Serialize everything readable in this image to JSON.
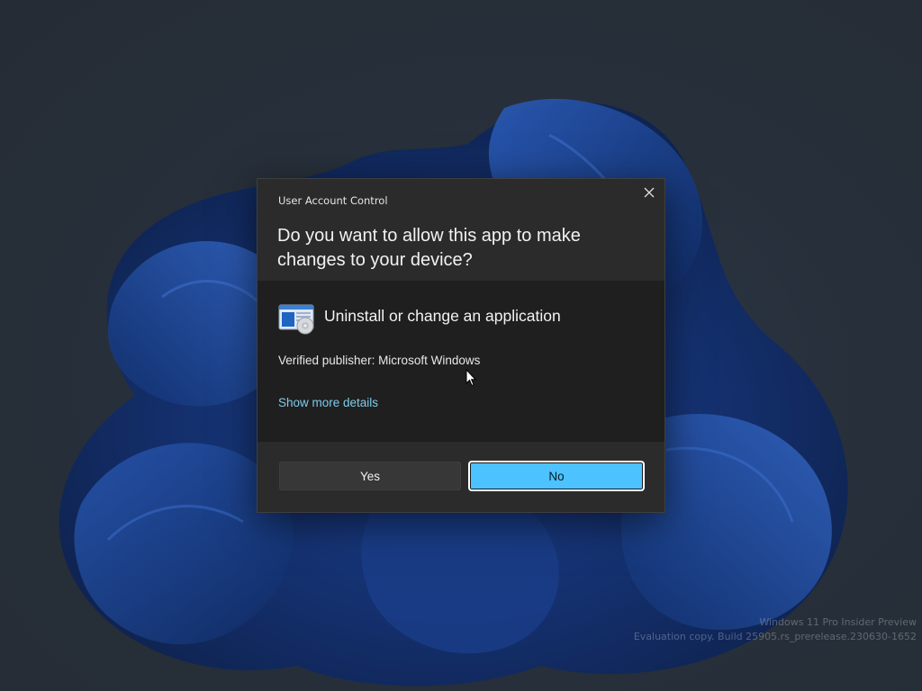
{
  "window": {
    "title": "User Account Control",
    "close_icon": "close-icon"
  },
  "prompt": {
    "headline": "Do you want to allow this app to make changes to your device?"
  },
  "app": {
    "icon": "program-settings-icon",
    "name": "Uninstall or change an application",
    "publisher": "Verified publisher: Microsoft Windows",
    "details_link": "Show more details"
  },
  "buttons": {
    "yes": "Yes",
    "no": "No"
  },
  "watermark": {
    "line1": "Windows 11 Pro Insider Preview",
    "line2": "Evaluation copy. Build 25905.rs_prerelease.230630-1652"
  },
  "colors": {
    "accent": "#4cc2ff",
    "link": "#7fcbeb",
    "dialog_bg": "#2b2b2b",
    "body_bg": "#1f1f1f"
  }
}
